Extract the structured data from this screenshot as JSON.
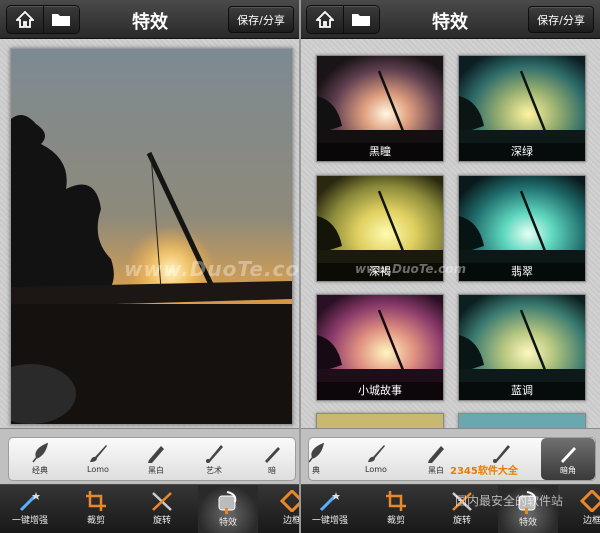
{
  "app": {
    "title": "特效",
    "save_label": "保存/分享"
  },
  "left": {
    "watermark": "www.DuoTe.com",
    "tools": [
      {
        "label": "经典",
        "icon": "feather-icon"
      },
      {
        "label": "Lomo",
        "icon": "brush-icon"
      },
      {
        "label": "黑白",
        "icon": "pencil-icon"
      },
      {
        "label": "艺术",
        "icon": "paint-icon"
      },
      {
        "label": "暗",
        "icon": "pen-icon"
      }
    ]
  },
  "right": {
    "effects": [
      "黑瞳",
      "深绿",
      "深褐",
      "翡翠",
      "小城故事",
      "蓝调"
    ],
    "tools": [
      {
        "label": "典",
        "icon": "feather-icon"
      },
      {
        "label": "Lomo",
        "icon": "brush-icon"
      },
      {
        "label": "黑白",
        "icon": "pencil-icon"
      },
      {
        "label": "",
        "icon": "paint-icon"
      },
      {
        "label": "暗角",
        "icon": "pen-icon",
        "selected": true
      }
    ],
    "logo_text": "2345软件大全",
    "watermark": "国内最安全的软件站",
    "watermark2": "www.DuoTe.com"
  },
  "nav": [
    {
      "label": "一键增强",
      "icon": "magic-wand-icon"
    },
    {
      "label": "裁剪",
      "icon": "crop-icon"
    },
    {
      "label": "旋转",
      "icon": "rotate-icon"
    },
    {
      "label": "特效",
      "icon": "effects-icon",
      "active": true
    },
    {
      "label": "边框",
      "icon": "frame-icon"
    }
  ],
  "colors": {
    "accent_orange": "#e8882a",
    "bar_dark": "#2a2a2a"
  }
}
